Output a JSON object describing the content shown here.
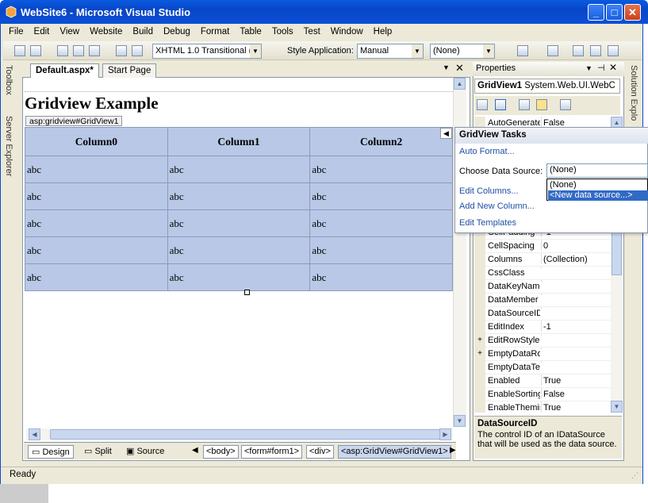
{
  "window": {
    "title": "WebSite6 - Microsoft Visual Studio",
    "minimize": "_",
    "maximize": "□",
    "close": "✕"
  },
  "menu": [
    "File",
    "Edit",
    "View",
    "Website",
    "Build",
    "Debug",
    "Format",
    "Table",
    "Tools",
    "Test",
    "Window",
    "Help"
  ],
  "toolbar": {
    "doctype": "XHTML 1.0 Transitional (",
    "style_app_label": "Style Application:",
    "style_app_value": "Manual",
    "target_rule": "(None)"
  },
  "left_tabs": {
    "toolbox": "Toolbox",
    "server_explorer": "Server Explorer"
  },
  "doc_tabs": {
    "active": "Default.aspx*",
    "other": "Start Page"
  },
  "designer": {
    "heading": "Gridview Example",
    "gridview_tag": "asp:gridview#GridView1",
    "columns": [
      "Column0",
      "Column1",
      "Column2"
    ],
    "rows": [
      [
        "abc",
        "abc",
        "abc"
      ],
      [
        "abc",
        "abc",
        "abc"
      ],
      [
        "abc",
        "abc",
        "abc"
      ],
      [
        "abc",
        "abc",
        "abc"
      ],
      [
        "abc",
        "abc",
        "abc"
      ]
    ]
  },
  "viewbar": {
    "design": "Design",
    "split": "Split",
    "source": "Source",
    "breadcrumbs": [
      "<body>",
      "<form#form1>",
      "<div>",
      "<asp:GridView#GridView1>"
    ]
  },
  "properties": {
    "title": "Properties",
    "object": "GridView1",
    "object_type": "System.Web.UI.WebC",
    "rows": [
      {
        "name": "AutoGenerate",
        "value": "False",
        "expand": ""
      },
      {
        "name": "CellPadding",
        "value": "-1",
        "expand": ""
      },
      {
        "name": "CellSpacing",
        "value": "0",
        "expand": ""
      },
      {
        "name": "Columns",
        "value": "(Collection)",
        "expand": ""
      },
      {
        "name": "CssClass",
        "value": "",
        "expand": ""
      },
      {
        "name": "DataKeyName",
        "value": "",
        "expand": ""
      },
      {
        "name": "DataMember",
        "value": "",
        "expand": ""
      },
      {
        "name": "DataSourceID",
        "value": "",
        "expand": ""
      },
      {
        "name": "EditIndex",
        "value": "-1",
        "expand": ""
      },
      {
        "name": "EditRowStyle",
        "value": "",
        "expand": "+"
      },
      {
        "name": "EmptyDataRo",
        "value": "",
        "expand": "+"
      },
      {
        "name": "EmptyDataTe",
        "value": "",
        "expand": ""
      },
      {
        "name": "Enabled",
        "value": "True",
        "expand": ""
      },
      {
        "name": "EnableSorting",
        "value": "False",
        "expand": ""
      },
      {
        "name": "EnableThemin",
        "value": "True",
        "expand": ""
      }
    ],
    "desc_title": "DataSourceID",
    "desc_text": "The control ID of an IDataSource that will be used as the data source."
  },
  "right_tabs": {
    "solution": "Solution Explo"
  },
  "tasks": {
    "title": "GridView Tasks",
    "auto_format": "Auto Format...",
    "choose_label": "Choose Data Source:",
    "choose_value": "(None)",
    "options": [
      "(None)",
      "<New data source...>"
    ],
    "edit_columns": "Edit Columns...",
    "add_column": "Add New Column...",
    "edit_templates": "Edit Templates"
  },
  "status": "Ready",
  "colors": {
    "title_bar": "#0a5be0",
    "grid_bg": "#b8c8e6",
    "link": "#1f4fa5",
    "selection": "#316ac5"
  }
}
